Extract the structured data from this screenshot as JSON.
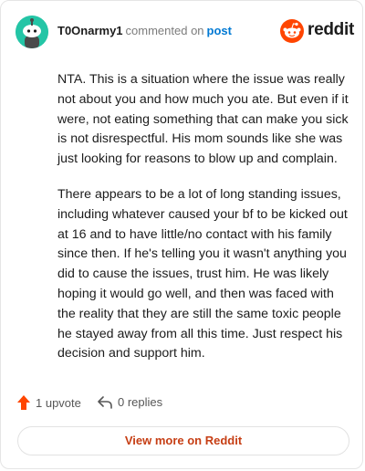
{
  "header": {
    "username": "T0Onarmy1",
    "commented_text": "commented on",
    "post_link": "post",
    "brand": "reddit",
    "brand_color": "#ff4500",
    "avatar_color": "#24c5a6"
  },
  "comment": {
    "paragraphs": [
      "NTA. This is a situation where the issue was really not about you and how much you ate. But even if it were, not eating something that can make you sick is not disrespectful. His mom sounds like she was just looking for reasons to blow up and complain.",
      "There appears to be a lot of long standing issues, including whatever caused your bf to be kicked out at 16 and to have little/no contact with his family since then. If he's telling you it wasn't anything you did to cause the issues, trust him. He was likely hoping it would go well, and then was faced with the reality that they are still the same toxic people he stayed away from all this time. Just respect his decision and support him."
    ]
  },
  "actions": {
    "upvotes": "1 upvote",
    "upvote_icon": "arrow-up-icon",
    "upvote_color": "#ff4500",
    "replies": "0 replies",
    "reply_icon": "reply-arrow-icon"
  },
  "footer": {
    "view_more": "View more on Reddit",
    "view_more_color": "#c63e14"
  }
}
